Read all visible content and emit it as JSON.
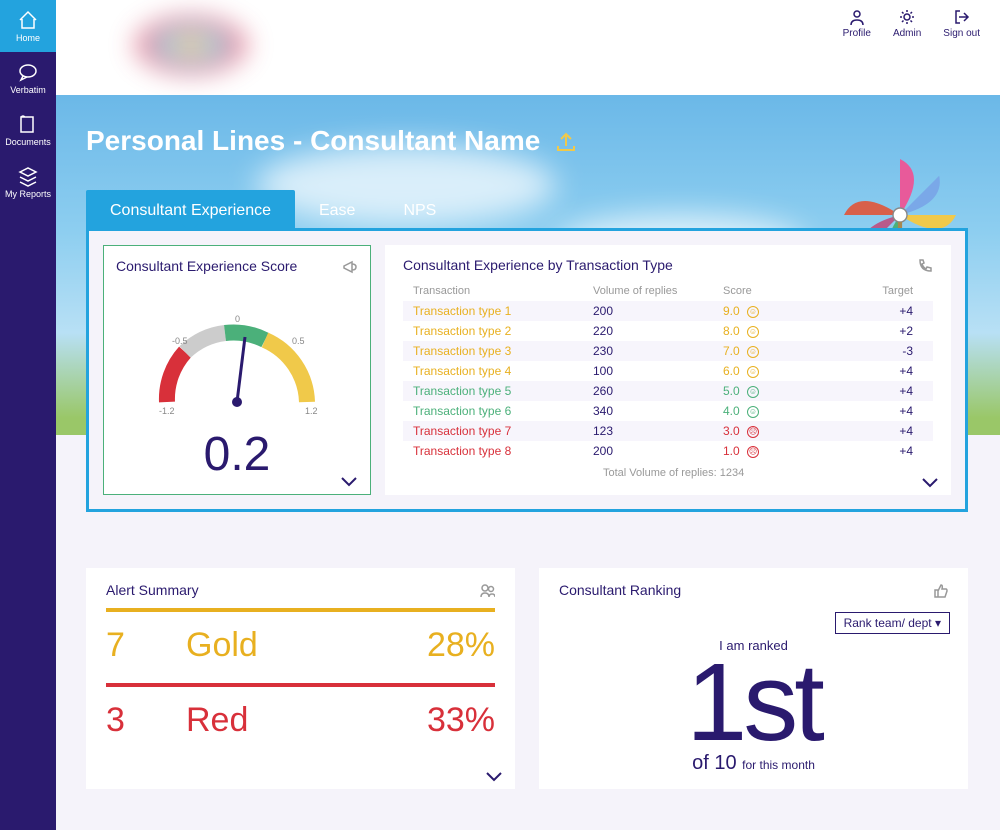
{
  "sidebar": {
    "items": [
      {
        "label": "Home"
      },
      {
        "label": "Verbatim"
      },
      {
        "label": "Documents"
      },
      {
        "label": "My Reports"
      }
    ]
  },
  "topbar": {
    "profile": "Profile",
    "admin": "Admin",
    "signout": "Sign out"
  },
  "page_title": "Personal Lines - Consultant Name",
  "tabs": [
    {
      "label": "Consultant Experience"
    },
    {
      "label": "Ease"
    },
    {
      "label": "NPS"
    }
  ],
  "gauge": {
    "title": "Consultant Experience Score",
    "value": "0.2",
    "ticks": {
      "min": "-1.2",
      "q1": "-0.5",
      "mid": "0",
      "q3": "0.5",
      "max": "1.2"
    }
  },
  "tx": {
    "title": "Consultant Experience by Transaction Type",
    "headers": {
      "name": "Transaction",
      "vol": "Volume of replies",
      "score": "Score",
      "target": "Target"
    },
    "rows": [
      {
        "name": "Transaction type 1",
        "vol": "200",
        "score": "9.0",
        "target": "+4",
        "color": "#e8b020",
        "face": "smile"
      },
      {
        "name": "Transaction type 2",
        "vol": "220",
        "score": "8.0",
        "target": "+2",
        "color": "#e8b020",
        "face": "smile"
      },
      {
        "name": "Transaction type 3",
        "vol": "230",
        "score": "7.0",
        "target": "-3",
        "color": "#e8b020",
        "face": "smile"
      },
      {
        "name": "Transaction type 4",
        "vol": "100",
        "score": "6.0",
        "target": "+4",
        "color": "#e8b020",
        "face": "smile"
      },
      {
        "name": "Transaction type 5",
        "vol": "260",
        "score": "5.0",
        "target": "+4",
        "color": "#4bb07a",
        "face": "neutral"
      },
      {
        "name": "Transaction type 6",
        "vol": "340",
        "score": "4.0",
        "target": "+4",
        "color": "#4bb07a",
        "face": "neutral"
      },
      {
        "name": "Transaction type 7",
        "vol": "123",
        "score": "3.0",
        "target": "+4",
        "color": "#d8303a",
        "face": "sad"
      },
      {
        "name": "Transaction type 8",
        "vol": "200",
        "score": "1.0",
        "target": "+4",
        "color": "#d8303a",
        "face": "sad"
      }
    ],
    "total": "Total Volume of replies: 1234"
  },
  "alerts": {
    "title": "Alert Summary",
    "gold": {
      "count": "7",
      "label": "Gold",
      "pct": "28%"
    },
    "red": {
      "count": "3",
      "label": "Red",
      "pct": "33%"
    }
  },
  "ranking": {
    "title": "Consultant Ranking",
    "selector": "Rank team/ dept",
    "intro": "I am ranked",
    "rank": "1st",
    "of_prefix": "of",
    "of_count": "10",
    "period": "for this month"
  },
  "chart_data": {
    "type": "bar",
    "title": "Consultant Experience by Transaction Type",
    "categories": [
      "Transaction type 1",
      "Transaction type 2",
      "Transaction type 3",
      "Transaction type 4",
      "Transaction type 5",
      "Transaction type 6",
      "Transaction type 7",
      "Transaction type 8"
    ],
    "series": [
      {
        "name": "Volume of replies",
        "values": [
          200,
          220,
          230,
          100,
          260,
          340,
          123,
          200
        ]
      },
      {
        "name": "Score",
        "values": [
          9.0,
          8.0,
          7.0,
          6.0,
          5.0,
          4.0,
          3.0,
          1.0
        ]
      },
      {
        "name": "Target",
        "values": [
          4,
          2,
          -3,
          4,
          4,
          4,
          4,
          4
        ]
      }
    ],
    "gauge": {
      "value": 0.2,
      "min": -1.2,
      "max": 1.2
    }
  }
}
